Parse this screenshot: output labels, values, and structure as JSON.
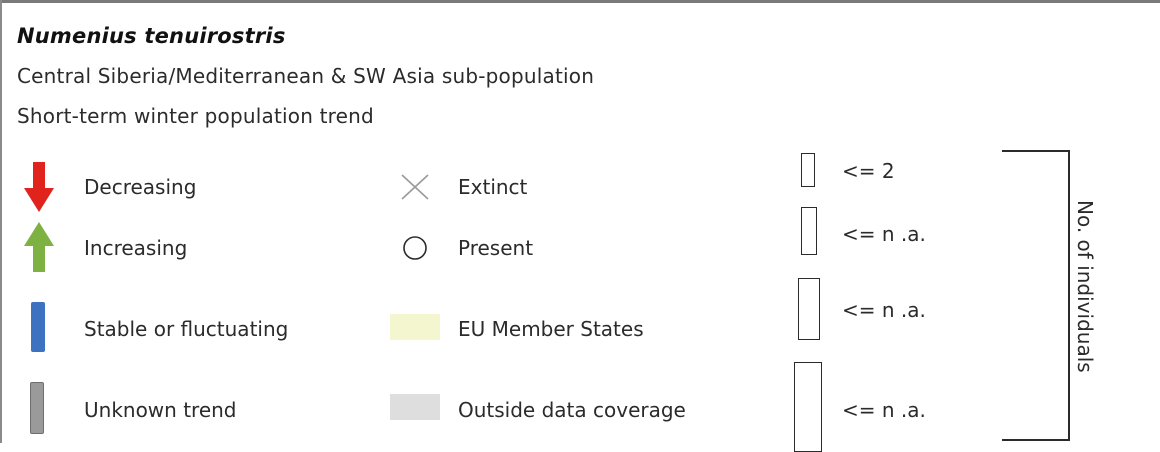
{
  "header": {
    "species": "Numenius tenuirostris",
    "population": "Central Siberia/Mediterranean & SW Asia sub-population",
    "trend_type": "Short-term winter population trend"
  },
  "trend_legend": [
    {
      "label": "Decreasing",
      "icon": "red-down-arrow-icon",
      "color": "#e0231d"
    },
    {
      "label": "Increasing",
      "icon": "green-up-arrow-icon",
      "color": "#7db142"
    },
    {
      "label": "Stable or fluctuating",
      "icon": "blue-bar-icon",
      "color": "#3c72bf"
    },
    {
      "label": "Unknown trend",
      "icon": "grey-bar-icon",
      "color": "#9a9a9a"
    }
  ],
  "status_legend": [
    {
      "label": "Extinct",
      "icon": "cross-icon"
    },
    {
      "label": "Present",
      "icon": "circle-icon"
    },
    {
      "label": "EU Member States",
      "icon": "yellow-swatch",
      "color": "#f3f6cf"
    },
    {
      "label": "Outside data coverage",
      "icon": "grey-swatch",
      "color": "#dedede"
    }
  ],
  "size_legend": {
    "title": "No. of individuals",
    "classes": [
      "<= 2",
      "<= n .a.",
      "<= n .a.",
      "<= n .a."
    ]
  }
}
